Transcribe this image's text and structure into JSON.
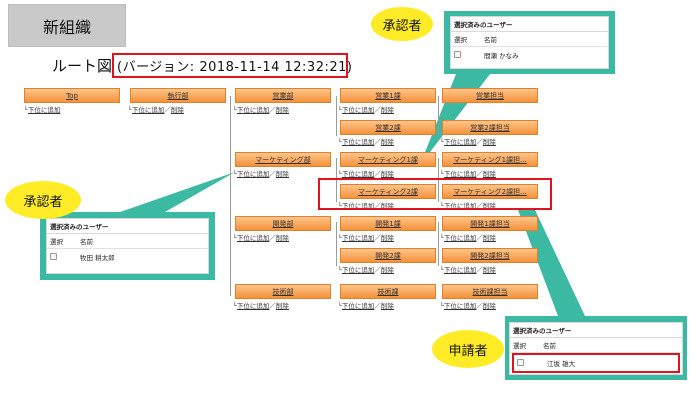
{
  "header": {
    "label": "新組織"
  },
  "route": {
    "title": "ルート図",
    "version": "(バージョン: 2018-11-14 12:32:21)"
  },
  "actions": {
    "add": "下位に追加",
    "sep": "／",
    "remove": "削除"
  },
  "tree": {
    "top": "Top",
    "exec": "執行部",
    "sales": "営業部",
    "sales1": "営業1課",
    "sales_tanto": "営業担当",
    "sales2": "営業2課",
    "sales2_tanto": "営業2課担当",
    "mkt": "マーケティング部",
    "mkt1": "マーケティング1課",
    "mkt1_tanto": "マーケティング1課担...",
    "mkt2": "マーケティング2課",
    "mkt2_tanto": "マーケティング2課担...",
    "dev": "開発部",
    "dev1": "開発1課",
    "dev1_tanto": "開発1課担当",
    "dev2": "開発2課",
    "dev2_tanto": "開発2課担当",
    "tech": "技術部",
    "tech_ka": "技術課",
    "tech_tanto": "技術課担当"
  },
  "callouts": {
    "approver_top": {
      "bubble": "承認者",
      "panel_title": "選択済みのユーザー",
      "col_select": "選択",
      "col_name": "名前",
      "user": "間瀬 かなみ"
    },
    "approver_left": {
      "bubble": "承認者",
      "panel_title": "選択済みのユーザー",
      "col_select": "選択",
      "col_name": "名前",
      "user": "牧田 耕太郎"
    },
    "applicant": {
      "bubble": "申請者",
      "panel_title": "選択済みのユーザー",
      "col_select": "選択",
      "col_name": "名前",
      "user": "江坂 雄大"
    }
  },
  "colors": {
    "teal": "#3cb9a2",
    "red": "#e0141e",
    "bubble": "#ffec26",
    "node": "#f4923a"
  }
}
